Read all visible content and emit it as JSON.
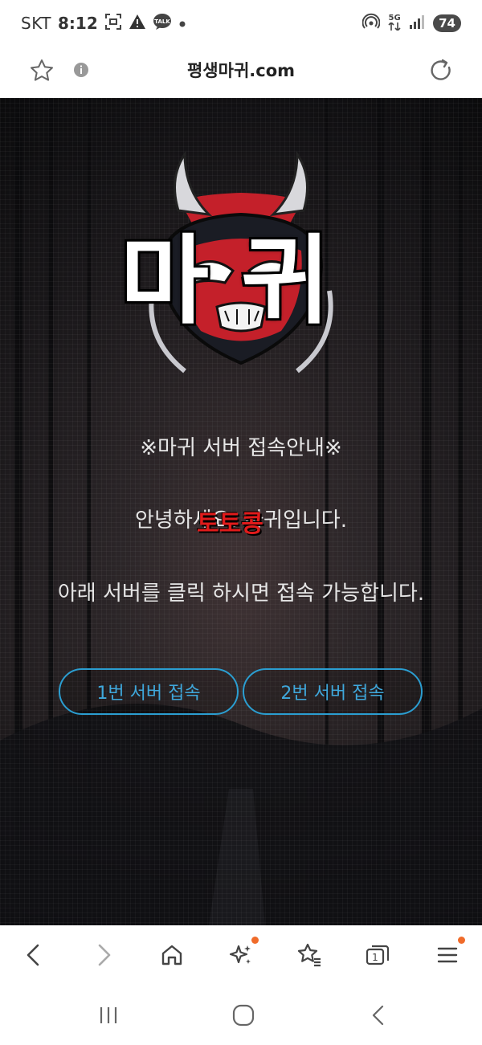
{
  "status_bar": {
    "carrier": "SKT",
    "time": "8:12",
    "network": "5G",
    "battery": "74",
    "left_icons": [
      "screenshot-icon",
      "warning-icon",
      "talk-icon",
      "dot-icon"
    ],
    "right_icons": [
      "hotspot-icon",
      "network-5g-icon",
      "signal-icon",
      "battery-icon"
    ],
    "talk_badge": "TALK"
  },
  "address_bar": {
    "url": "평생마귀.com",
    "icons": [
      "star-icon",
      "info-icon",
      "reload-icon"
    ]
  },
  "page": {
    "logo_text": "마귀",
    "heading": "※마귀 서버 접속안내※",
    "line1": "안녕하세요. 마귀입니다.",
    "watermark": "토토콩",
    "line2": "아래 서버를 클릭 하시면 접속 가능합니다.",
    "buttons": [
      {
        "label": "1번 서버 접속"
      },
      {
        "label": "2번 서버 접속"
      }
    ],
    "colors": {
      "button_accent": "#2b9ed1",
      "watermark_red": "#e11b1b",
      "mask_red": "#c4202a"
    }
  },
  "toolbar": {
    "tab_count": "1",
    "items": [
      "back-icon",
      "forward-icon",
      "home-icon",
      "sparkle-icon",
      "bookmarks-icon",
      "tabs-icon",
      "menu-icon"
    ]
  },
  "navbar": {
    "items": [
      "recent-apps-icon",
      "home-circle-icon",
      "system-back-icon"
    ]
  }
}
